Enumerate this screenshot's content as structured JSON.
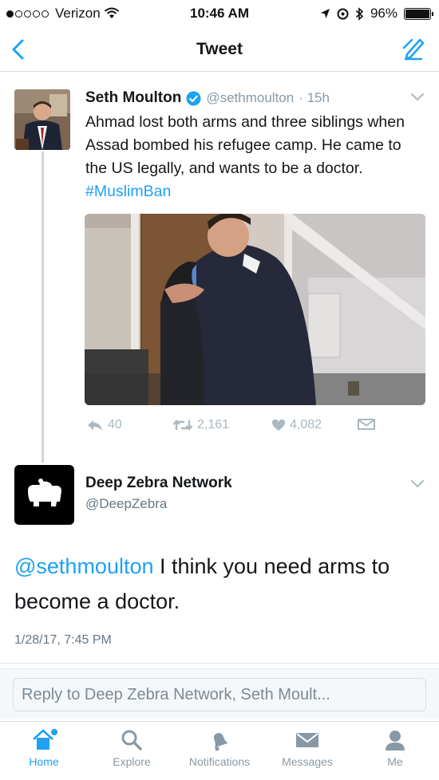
{
  "status_bar": {
    "carrier": "Verizon",
    "time": "10:46 AM",
    "battery": "96%"
  },
  "nav": {
    "title": "Tweet"
  },
  "tweet": {
    "author_name": "Seth Moulton",
    "author_handle": "@sethmoulton",
    "age": "· 15h",
    "text": "Ahmad lost both arms and three siblings when Assad bombed his refugee camp. He came to the US legally, and wants to be a doctor.",
    "hashtag": "#MuslimBan",
    "replies": "40",
    "retweets": "2,161",
    "likes": "4,082"
  },
  "reply_tweet": {
    "author_name": "Deep Zebra Network",
    "author_handle": "@DeepZebra",
    "mention": "@sethmoulton",
    "text": " I think you need arms to become a doctor.",
    "timestamp": "1/28/17, 7:45 PM"
  },
  "reply_box": {
    "placeholder": "Reply to Deep Zebra Network, Seth Moult..."
  },
  "tabs": [
    {
      "label": "Home",
      "icon": "home-icon",
      "active": true
    },
    {
      "label": "Explore",
      "icon": "search-icon",
      "active": false
    },
    {
      "label": "Notifications",
      "icon": "bell-icon",
      "active": false
    },
    {
      "label": "Messages",
      "icon": "envelope-icon",
      "active": false
    },
    {
      "label": "Me",
      "icon": "person-icon",
      "active": false
    }
  ],
  "colors": {
    "accent": "#1da1f2",
    "muted": "#8899a6"
  }
}
